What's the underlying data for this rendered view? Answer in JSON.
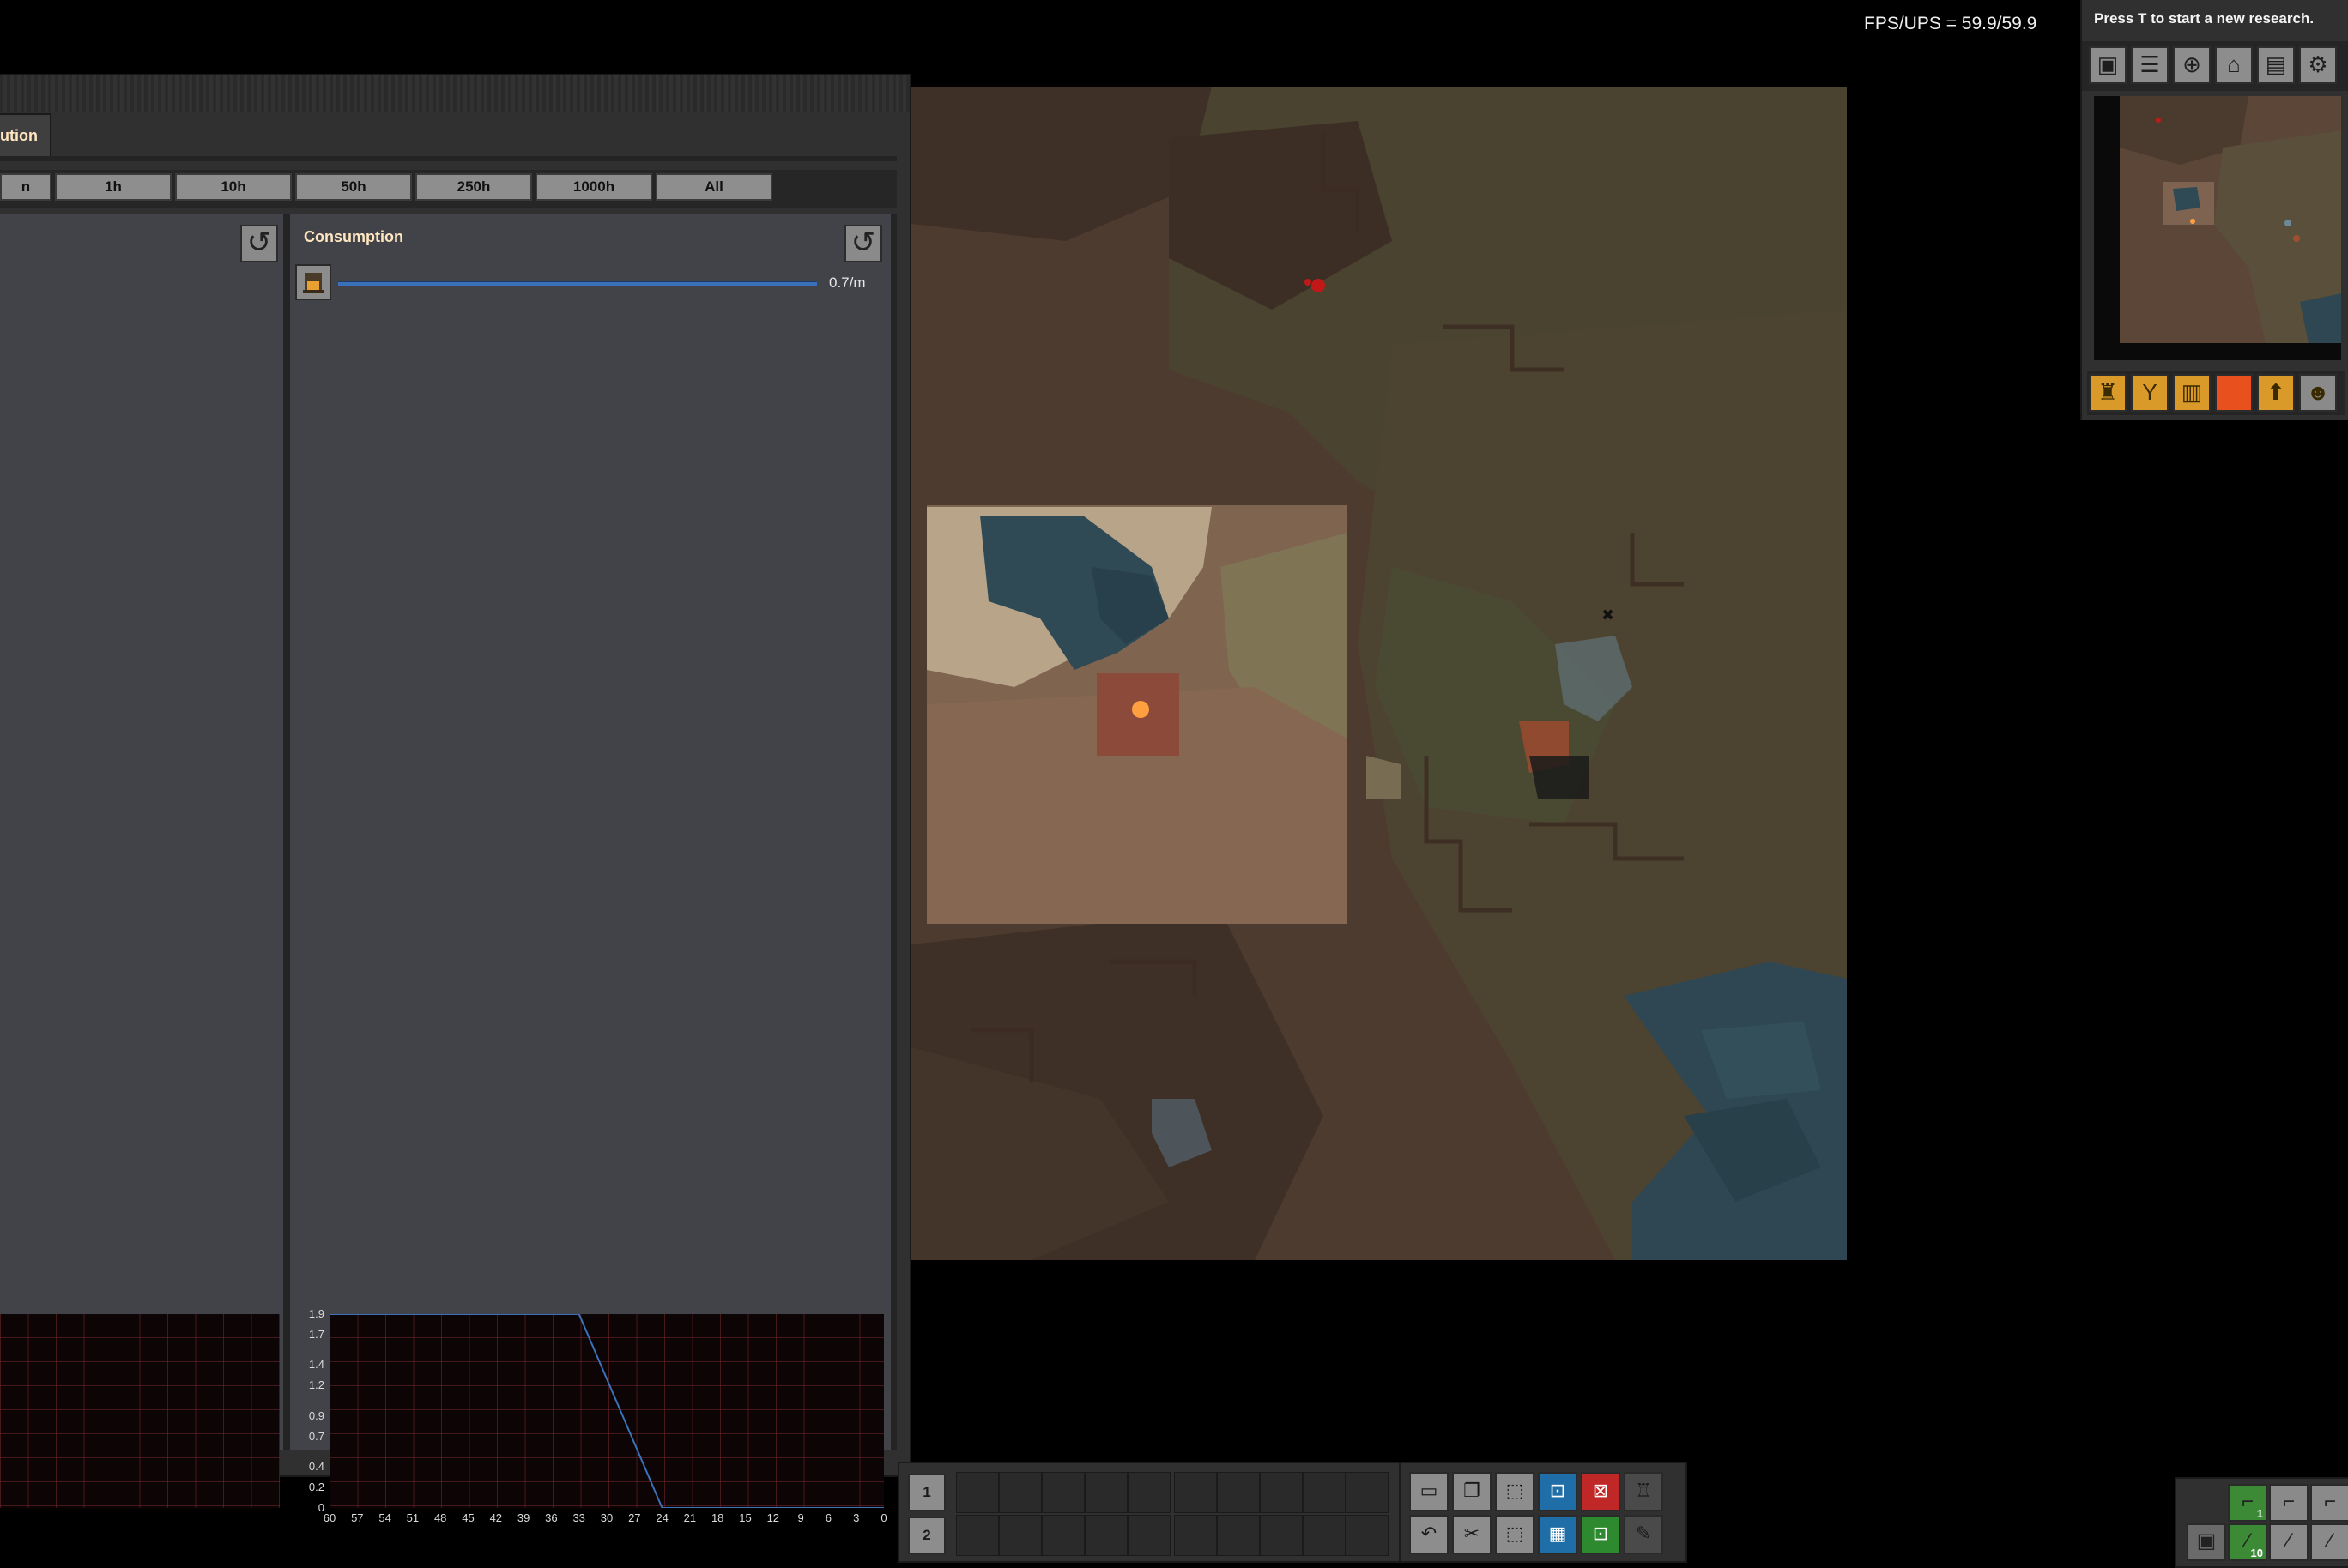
{
  "performance": {
    "fps_label": "FPS/UPS = 59.9/59.9"
  },
  "research": {
    "hint": "Press T to start a new research.",
    "toolbar_icons": [
      "blueprint-library-icon",
      "production-stats-icon",
      "map-pins-icon",
      "technology-icon",
      "trains-icon",
      "settings-icon"
    ],
    "shortcut_icons": [
      "gun-turret-icon",
      "inserter-icon",
      "assembler-icon",
      "ammo-icon",
      "pipe-icon",
      "character-icon"
    ]
  },
  "stats_window": {
    "tab_label": "ution",
    "time_buttons": [
      "n",
      "1h",
      "10h",
      "50h",
      "250h",
      "1000h",
      "All"
    ],
    "consumption": {
      "title": "Consumption",
      "item_icon": "stone-furnace-icon",
      "rate": "0.7/m"
    },
    "graph": {
      "y_ticks": [
        "1.9",
        "1.7",
        "1.4",
        "1.2",
        "0.9",
        "0.7",
        "0.4",
        "0.2",
        "0"
      ],
      "x_ticks": [
        "60",
        "57",
        "54",
        "51",
        "48",
        "45",
        "42",
        "39",
        "36",
        "33",
        "30",
        "27",
        "24",
        "21",
        "18",
        "15",
        "12",
        "9",
        "6",
        "3",
        "0"
      ]
    }
  },
  "chart_data": {
    "type": "line",
    "x": [
      60,
      45,
      36,
      33,
      24,
      0
    ],
    "series": [
      {
        "values": [
          1.9,
          1.9,
          1.9,
          1.9,
          0,
          0
        ]
      }
    ],
    "xlim": [
      60,
      0
    ],
    "ylim": [
      0,
      1.9
    ],
    "grid": true
  },
  "quickbar": {
    "rows": [
      "1",
      "2"
    ],
    "tool_icons_row1": [
      "hotkey-icon",
      "copy-icon",
      "blueprint-select-icon",
      "deconstruct-select-icon",
      "deconstruct-icon",
      "artillery-icon"
    ],
    "tool_icons_row2": [
      "undo-icon",
      "cut-icon",
      "paste-icon",
      "blueprint-book-icon",
      "upgrade-icon",
      "spidertron-icon"
    ]
  },
  "weapons": {
    "slots": [
      {
        "icon": "submachine-gun-icon",
        "count": "1",
        "active": true
      },
      {
        "icon": "pistol-icon",
        "count": "",
        "active": false
      },
      {
        "icon": "shotgun-icon",
        "count": "",
        "active": false
      }
    ],
    "ammo": [
      {
        "icon": "firearm-magazine-icon",
        "count": "10",
        "active": true
      },
      {
        "icon": "ammo-empty-icon",
        "count": "",
        "active": false
      },
      {
        "icon": "ammo-empty-icon",
        "count": "",
        "active": false
      }
    ]
  },
  "colors": {
    "map_base": "#4b3a2e",
    "water": "#2e4752",
    "bar_blue": "#3a71b8",
    "player_marker": "#ffa040",
    "enemy_red": "#c21818",
    "accent_orange": "#e07a1e"
  }
}
